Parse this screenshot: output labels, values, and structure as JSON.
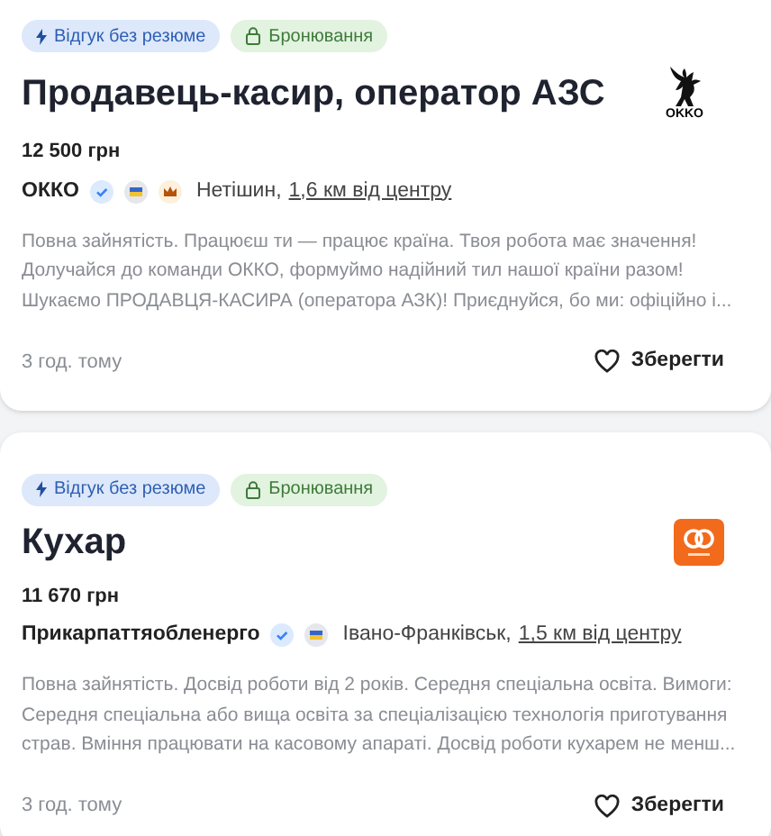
{
  "vacancies": [
    {
      "tags": [
        {
          "kind": "quick",
          "label": "Відгук без резюме"
        },
        {
          "kind": "reserve",
          "label": "Бронювання"
        }
      ],
      "title": "Продавець-касир, оператор АЗС",
      "logo": {
        "kind": "dragon",
        "text": "OKKO"
      },
      "salary": "12 500 грн",
      "company": "ОККО",
      "company_marks": [
        {
          "kind": "verified"
        },
        {
          "kind": "flag"
        },
        {
          "kind": "crown"
        }
      ],
      "city": "Нетішин,",
      "distance": "1,6 км від центру",
      "description": "Повна зайнятість. Працюєш ти — працює країна. Твоя робота має значення! Долучайся до команди ОККО, формуймо надійний тил нашої країни разом! Шукаємо ПРОДАВЦЯ-КАСИРА (оператора АЗК)! Приєднуйся, бо ми: офіційно і...",
      "time": "3 год. тому",
      "save": "Зберегти"
    },
    {
      "tags": [
        {
          "kind": "quick",
          "label": "Відгук без резюме"
        },
        {
          "kind": "reserve",
          "label": "Бронювання"
        }
      ],
      "title": "Кухар",
      "logo": {
        "kind": "orange"
      },
      "salary": "11 670 грн",
      "company": "Прикарпаттяобленерго",
      "company_marks": [
        {
          "kind": "verified"
        },
        {
          "kind": "flag"
        }
      ],
      "city": "Івано-Франківськ,",
      "distance": "1,5 км від центру",
      "description": "Повна зайнятість. Досвід роботи від 2 років. Середня спеціальна освіта. Вимоги: Середня спеціальна або вища освіта за спеціалізацією технологія приготування страв. Вміння працювати на касовому апараті. Досвід роботи кухарем не менш...",
      "time": "3 год. тому",
      "save": "Зберегти"
    }
  ]
}
